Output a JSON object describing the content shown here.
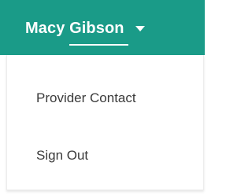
{
  "header": {
    "user_name": "Macy Gibson",
    "dropdown_icon": "caret-down-icon",
    "background_color": "#1a9b88"
  },
  "menu": {
    "items": [
      {
        "label": "Provider Contact"
      },
      {
        "label": "Sign Out"
      }
    ]
  }
}
